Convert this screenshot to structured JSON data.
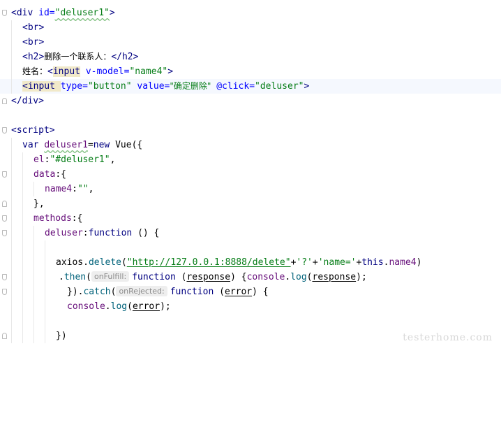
{
  "lines": [
    {
      "tokens": [
        "<div ",
        "id=",
        "\"deluser1\"",
        ">"
      ]
    },
    {
      "tokens": [
        "<br>"
      ]
    },
    {
      "tokens": [
        "<br>"
      ]
    },
    {
      "tokens": [
        "<h2>",
        "删除一个联系人：",
        "</h2>"
      ]
    },
    {
      "tokens": [
        "姓名：",
        "<",
        "input",
        " ",
        "v-model=",
        "\"name4\"",
        ">"
      ]
    },
    {
      "tokens": [
        "<input ",
        "type=",
        "\"button\"",
        " value=",
        "\"确定删除\"",
        " @click=",
        "\"deluser\"",
        ">"
      ]
    },
    {
      "tokens": [
        "</div>"
      ]
    },
    {
      "tokens": [
        ""
      ]
    },
    {
      "tokens": [
        "<script>"
      ]
    },
    {
      "tokens": [
        "var ",
        "deluser1",
        "=",
        "new ",
        "Vue",
        "({"
      ]
    },
    {
      "tokens": [
        "el",
        ":",
        "\"#deluser1\"",
        ","
      ]
    },
    {
      "tokens": [
        "data",
        ":{"
      ]
    },
    {
      "tokens": [
        "name4",
        ":",
        "\"\"",
        ","
      ]
    },
    {
      "tokens": [
        "},"
      ]
    },
    {
      "tokens": [
        "methods",
        ":{"
      ]
    },
    {
      "tokens": [
        "deluser",
        ":",
        "function",
        " () {"
      ]
    },
    {
      "tokens": [
        ""
      ]
    },
    {
      "tokens": [
        "axios.",
        "delete",
        "(",
        "\"http://127.0.0.1:8888/delete\"",
        "+",
        "'?'",
        "+",
        "'name='",
        "+",
        "this",
        ".",
        "name4",
        ")"
      ]
    },
    {
      "tokens": [
        ".",
        "then",
        "(",
        "onFulfill:",
        "function",
        " (",
        "response",
        ") {",
        "console",
        ".",
        "log",
        "(",
        "response",
        ");"
      ]
    },
    {
      "tokens": [
        "}).",
        "catch",
        "(",
        "onRejected:",
        "function",
        " (",
        "error",
        ") {"
      ]
    },
    {
      "tokens": [
        "console",
        ".",
        "log",
        "(",
        "error",
        ");"
      ]
    },
    {
      "tokens": [
        ""
      ]
    },
    {
      "tokens": [
        "})"
      ]
    }
  ],
  "watermark": "testerhome.com",
  "colors": {
    "tag": "#000080",
    "attribute": "#0000ff",
    "string": "#067d17",
    "property": "#660e7a",
    "function": "#00627a",
    "current_line_bg": "#f5f8fe",
    "inlay_hint_bg": "#eeeeee"
  }
}
